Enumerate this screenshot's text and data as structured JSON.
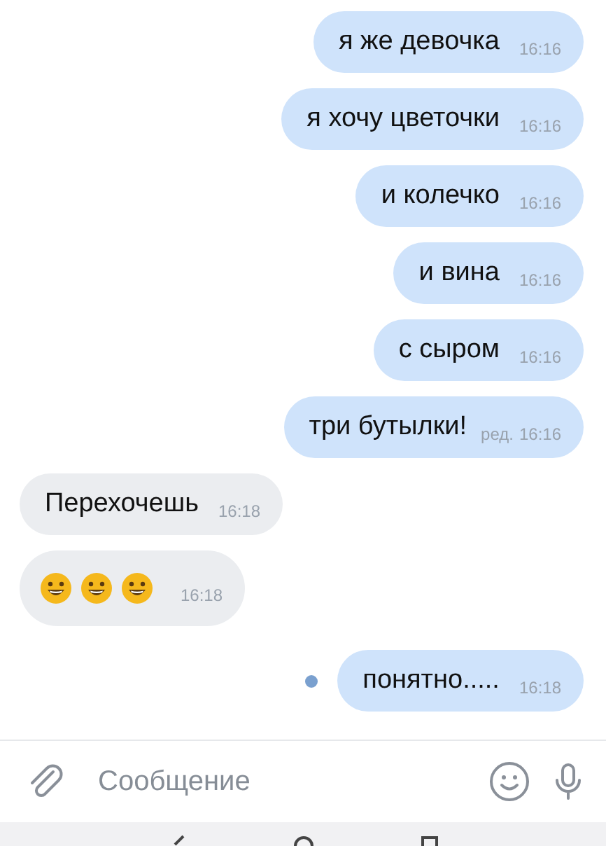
{
  "messages": [
    {
      "outgoing": true,
      "kind": "text",
      "text": "я же девочка",
      "time": "16:16"
    },
    {
      "outgoing": true,
      "kind": "text",
      "text": "я хочу цветочки",
      "time": "16:16"
    },
    {
      "outgoing": true,
      "kind": "text",
      "text": "и колечко",
      "time": "16:16"
    },
    {
      "outgoing": true,
      "kind": "text",
      "text": "и вина",
      "time": "16:16"
    },
    {
      "outgoing": true,
      "kind": "text",
      "text": "с сыром",
      "time": "16:16"
    },
    {
      "outgoing": true,
      "kind": "text",
      "text": "три бутылки!",
      "edited_label": "ред.",
      "time": "16:16"
    },
    {
      "outgoing": false,
      "kind": "text",
      "text": "Перехочешь",
      "time": "16:18"
    },
    {
      "outgoing": false,
      "kind": "emoji",
      "time": "16:18"
    },
    {
      "outgoing": true,
      "kind": "text",
      "text": "понятно.....",
      "time": "16:18",
      "unread": true
    }
  ],
  "composer": {
    "placeholder": "Сообщение"
  }
}
